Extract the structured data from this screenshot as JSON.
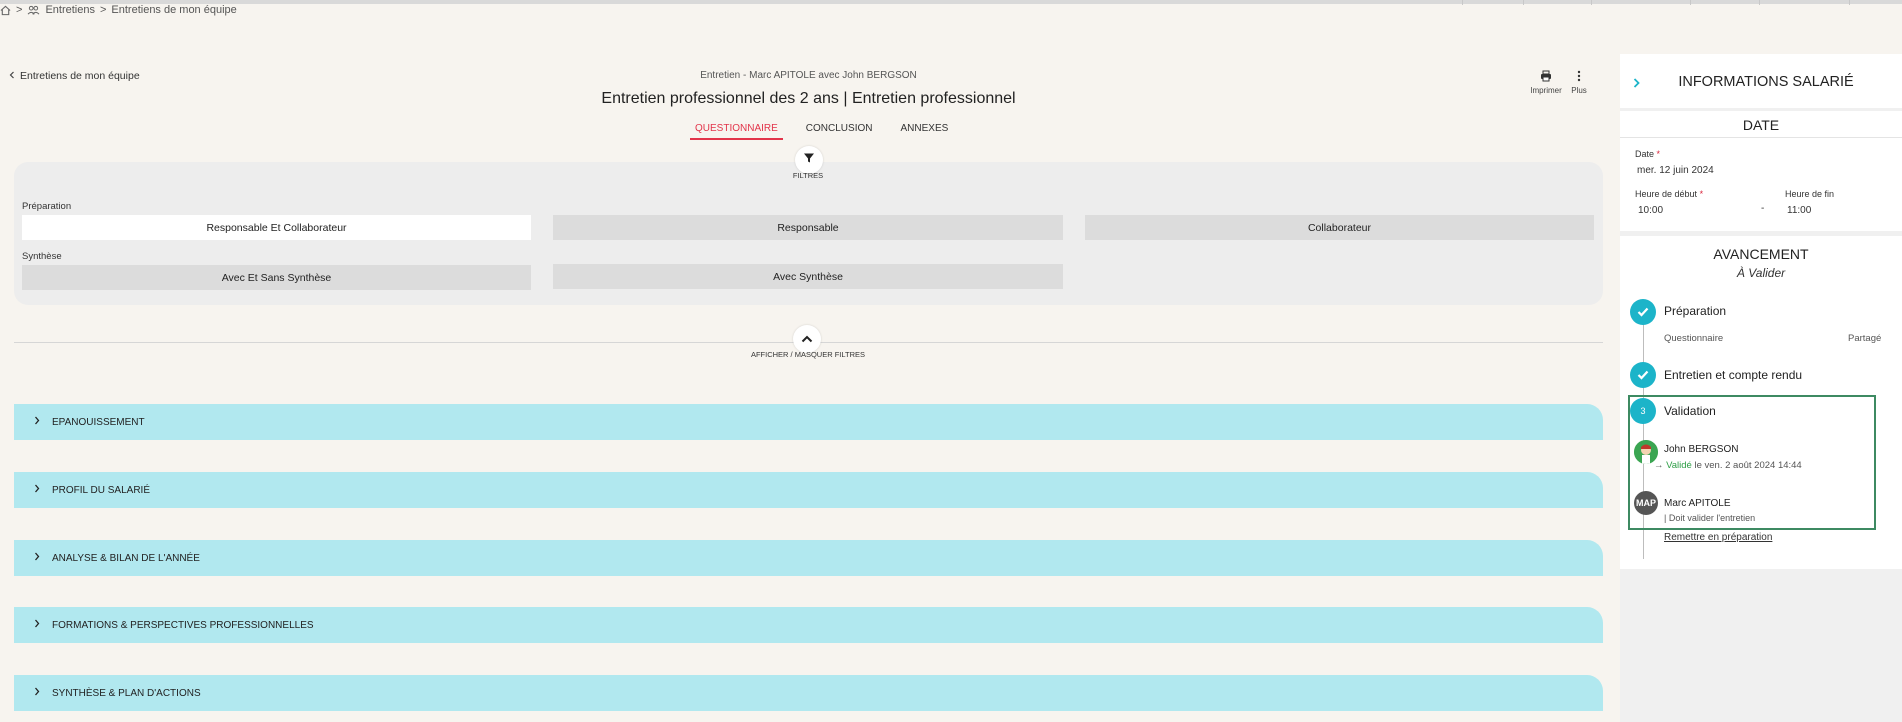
{
  "breadcrumb": {
    "items": [
      "Entretiens",
      "Entretiens de mon équipe"
    ],
    "separator": ">"
  },
  "header": {
    "back_label": "Entretiens de mon équipe",
    "subtitle": "Entretien - Marc APITOLE avec John BERGSON",
    "title": "Entretien professionnel des 2 ans | Entretien professionnel",
    "print_label": "Imprimer",
    "more_label": "Plus"
  },
  "tabs": [
    {
      "label": "QUESTIONNAIRE",
      "active": true
    },
    {
      "label": "CONCLUSION",
      "active": false
    },
    {
      "label": "ANNEXES",
      "active": false
    }
  ],
  "filters": {
    "label": "FILTRES",
    "preparation_label": "Préparation",
    "preparation_options": [
      "Responsable Et Collaborateur",
      "Responsable",
      "Collaborateur"
    ],
    "preparation_selected": "Responsable Et Collaborateur",
    "synthese_label": "Synthèse",
    "synthese_options": [
      "Avec Et Sans Synthèse",
      "Avec Synthèse"
    ],
    "toggle_label": "AFFICHER / MASQUER FILTRES"
  },
  "sections": [
    "EPANOUISSEMENT",
    "PROFIL DU SALARIÉ",
    "ANALYSE & BILAN DE L'ANNÉE",
    "FORMATIONS & PERSPECTIVES PROFESSIONNELLES",
    "SYNTHÈSE & PLAN D'ACTIONS"
  ],
  "right_panel": {
    "title": "INFORMATIONS SALARIÉ",
    "date_card": {
      "title": "DATE",
      "date_label": "Date",
      "date_value": "mer. 12 juin 2024",
      "start_label": "Heure de début",
      "start_value": "10:00",
      "separator": "-",
      "end_label": "Heure de fin",
      "end_value": "11:00",
      "required_mark": "*"
    },
    "progress": {
      "title": "AVANCEMENT",
      "status": "À Valider",
      "steps": [
        {
          "title": "Préparation",
          "sub_left": "Questionnaire",
          "sub_right": "Partagé"
        },
        {
          "title": "Entretien et compte rendu"
        },
        {
          "title": "Validation",
          "number": "3"
        }
      ],
      "validators": [
        {
          "name": "John BERGSON",
          "prefix": "→",
          "status_word": "Validé",
          "status_rest": " le ven. 2 août 2024 14:44"
        },
        {
          "name": "Marc APITOLE",
          "initials": "MAP",
          "status": "| Doit valider l'entretien"
        }
      ],
      "reset_link": "Remettre en préparation"
    }
  },
  "colors": {
    "accent_red": "#e2344a",
    "section_bg": "#b1e8ef",
    "step_teal": "#1cb4c9",
    "validation_border": "#3d8a62",
    "valid_green": "#2d9e46"
  }
}
